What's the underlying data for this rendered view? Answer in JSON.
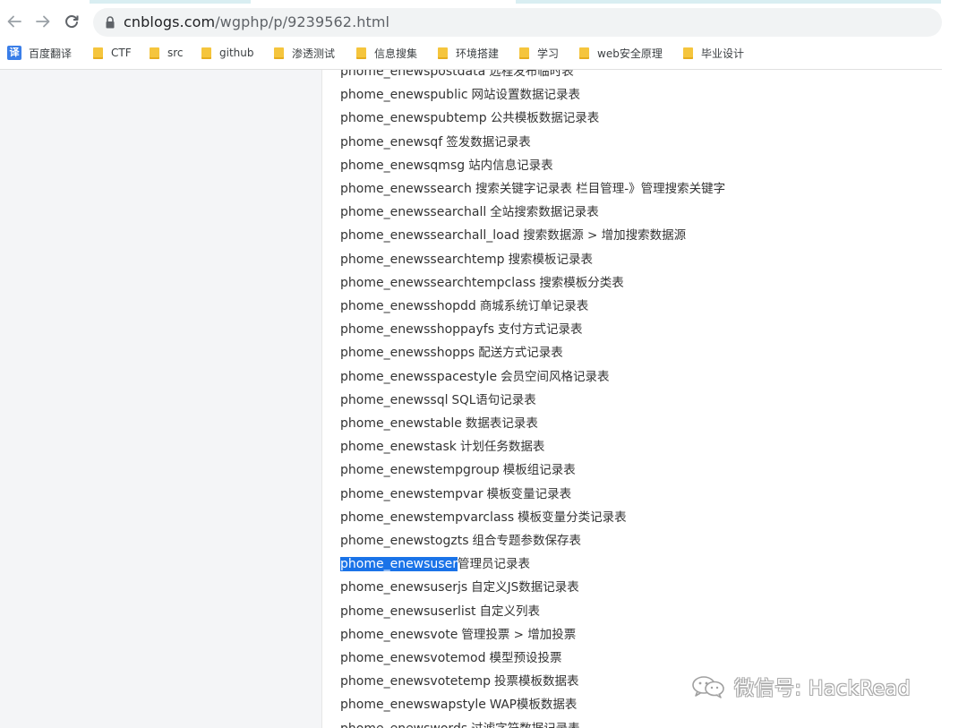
{
  "toolbar": {
    "url_domain": "cnblogs.com",
    "url_path": "/wgphp/p/9239562.html"
  },
  "bookmarks": [
    {
      "label": "百度翻译",
      "icon": "translate-icon"
    },
    {
      "label": "CTF",
      "icon": "folder-icon"
    },
    {
      "label": "src",
      "icon": "folder-icon"
    },
    {
      "label": "github",
      "icon": "folder-icon"
    },
    {
      "label": "渗透测试",
      "icon": "folder-icon"
    },
    {
      "label": "信息搜集",
      "icon": "folder-icon"
    },
    {
      "label": "环境搭建",
      "icon": "folder-icon"
    },
    {
      "label": "学习",
      "icon": "folder-icon"
    },
    {
      "label": "web安全原理",
      "icon": "folder-icon"
    },
    {
      "label": "毕业设计",
      "icon": "folder-icon"
    }
  ],
  "content": {
    "lines": [
      {
        "table": "phome_enewspostdata",
        "desc": "远程发布临时表"
      },
      {
        "table": "phome_enewspublic",
        "desc": "网站设置数据记录表"
      },
      {
        "table": "phome_enewspubtemp",
        "desc": "公共模板数据记录表"
      },
      {
        "table": "phome_enewsqf",
        "desc": "签发数据记录表"
      },
      {
        "table": "phome_enewsqmsg",
        "desc": "站内信息记录表"
      },
      {
        "table": "phome_enewssearch",
        "desc": "搜索关键字记录表 栏目管理-》管理搜索关键字"
      },
      {
        "table": "phome_enewssearchall",
        "desc": "全站搜索数据记录表"
      },
      {
        "table": "phome_enewssearchall_load",
        "desc": "搜索数据源 > 增加搜索数据源"
      },
      {
        "table": "phome_enewssearchtemp",
        "desc": "搜索模板记录表"
      },
      {
        "table": "phome_enewssearchtempclass",
        "desc": "搜索模板分类表"
      },
      {
        "table": "phome_enewsshopdd",
        "desc": "商城系统订单记录表"
      },
      {
        "table": "phome_enewsshoppayfs",
        "desc": "支付方式记录表"
      },
      {
        "table": "phome_enewsshopps",
        "desc": "配送方式记录表"
      },
      {
        "table": "phome_enewsspacestyle",
        "desc": "会员空间风格记录表"
      },
      {
        "table": "phome_enewssql",
        "desc": "SQL语句记录表"
      },
      {
        "table": "phome_enewstable",
        "desc": "数据表记录表"
      },
      {
        "table": "phome_enewstask",
        "desc": "计划任务数据表"
      },
      {
        "table": "phome_enewstempgroup",
        "desc": "模板组记录表"
      },
      {
        "table": "phome_enewstempvar",
        "desc": "模板变量记录表"
      },
      {
        "table": "phome_enewstempvarclass",
        "desc": "模板变量分类记录表"
      },
      {
        "table": "phome_enewstogzts",
        "desc": "组合专题参数保存表"
      },
      {
        "table": "phome_enewsuser",
        "desc": "管理员记录表",
        "selected": true
      },
      {
        "table": "phome_enewsuserjs",
        "desc": "自定义JS数据记录表"
      },
      {
        "table": "phome_enewsuserlist",
        "desc": "自定义列表"
      },
      {
        "table": "phome_enewsvote",
        "desc": "管理投票 > 增加投票"
      },
      {
        "table": "phome_enewsvotemod",
        "desc": "模型预设投票"
      },
      {
        "table": "phome_enewsvotetemp",
        "desc": "投票模板数据表"
      },
      {
        "table": "phome_enewswapstyle",
        "desc": "WAP模板数据表"
      },
      {
        "table": "phome_enewswords",
        "desc": "过滤字符数据记录表"
      }
    ]
  },
  "watermark": {
    "text": "微信号: HackRead"
  },
  "colors": {
    "selection": "#1a73e8",
    "omnibox_bg": "#f1f3f4",
    "folder": "#f5c53d",
    "left_panel": "#f4f5f7"
  }
}
